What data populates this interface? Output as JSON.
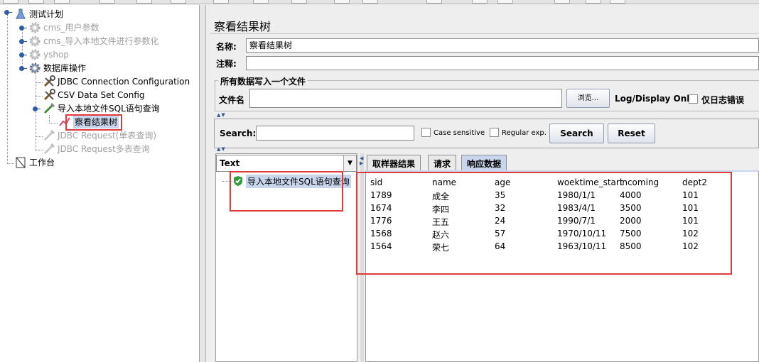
{
  "tree": {
    "root": "测试计划",
    "items": [
      {
        "label": "cms_用户参数",
        "enabled": false
      },
      {
        "label": "cms_导入本地文件进行参数化",
        "enabled": false
      },
      {
        "label": "yshop",
        "enabled": false
      },
      {
        "label": "数据库操作",
        "enabled": true
      },
      {
        "label": "JDBC Connection Configuration",
        "enabled": true
      },
      {
        "label": "CSV Data Set Config",
        "enabled": true
      },
      {
        "label": "导入本地文件SQL语句查询",
        "enabled": true
      },
      {
        "label": "察看结果树",
        "enabled": true
      },
      {
        "label": "JDBC Request(单表查询)",
        "enabled": false
      },
      {
        "label": "JDBC Request多表查询",
        "enabled": false
      }
    ],
    "workbench": "工作台"
  },
  "panel": {
    "title": "察看结果树",
    "name_label": "名称:",
    "name_value": "察看结果树",
    "comment_label": "注释:",
    "comment_value": "",
    "file_group_title": "所有数据写入一个文件",
    "filename_label": "文件名",
    "filename_value": "",
    "browse_label": "浏览...",
    "log_display_label": "Log/Display Only:",
    "errors_only_label": "仅日志错误"
  },
  "search": {
    "label": "Search:",
    "value": "",
    "case_sensitive_label": "Case sensitive",
    "regex_label": "Regular exp.",
    "search_button": "Search",
    "reset_button": "Reset"
  },
  "results": {
    "renderer": "Text",
    "sample_label": "导入本地文件SQL语句查询",
    "tabs": [
      "取样器结果",
      "请求",
      "响应数据"
    ],
    "active_tab": 2
  },
  "response": {
    "columns": [
      "sid",
      "name",
      "age",
      "woektime_start",
      "incoming",
      "dept2"
    ],
    "rows": [
      [
        "1789",
        "成全",
        "35",
        "1980/1/1",
        "4000",
        "101"
      ],
      [
        "1674",
        "李四",
        "32",
        "1983/4/1",
        "3500",
        "101"
      ],
      [
        "1776",
        "王五",
        "24",
        "1990/7/1",
        "2000",
        "101"
      ],
      [
        "1568",
        "赵六",
        "57",
        "1970/10/11",
        "7500",
        "102"
      ],
      [
        "1564",
        "荣七",
        "64",
        "1963/10/11",
        "8500",
        "102"
      ]
    ]
  },
  "colors": {
    "highlight_red": "#e23a3a",
    "selection_blue": "#c7d6ec",
    "success_green": "#2e9e3a"
  }
}
